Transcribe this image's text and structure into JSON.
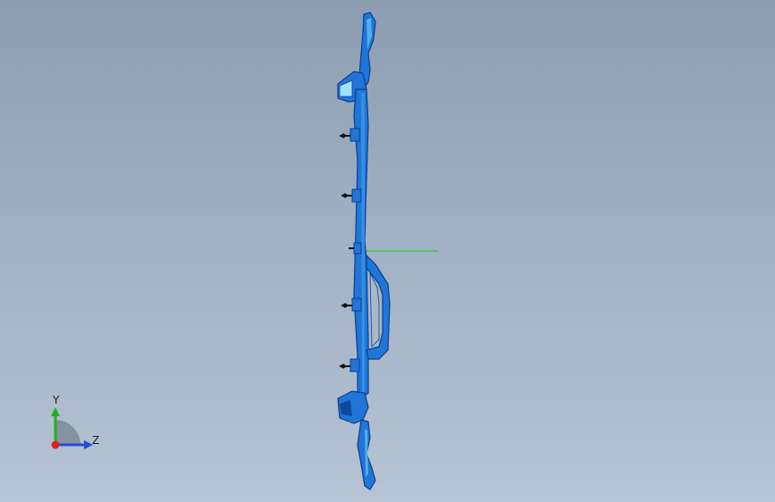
{
  "viewport": {
    "background_top": "#8c9db1",
    "background_bottom": "#b6c4d3"
  },
  "model": {
    "part_color": "#1f76d6",
    "part_dark": "#0b3f8f",
    "part_light": "#6fc3f5",
    "origin_axis_color": "#22c422"
  },
  "triad": {
    "y_label": "Y",
    "z_label": "Z",
    "y_color": "#21b021",
    "z_color": "#1f4ed6",
    "x_color": "#e02020"
  }
}
